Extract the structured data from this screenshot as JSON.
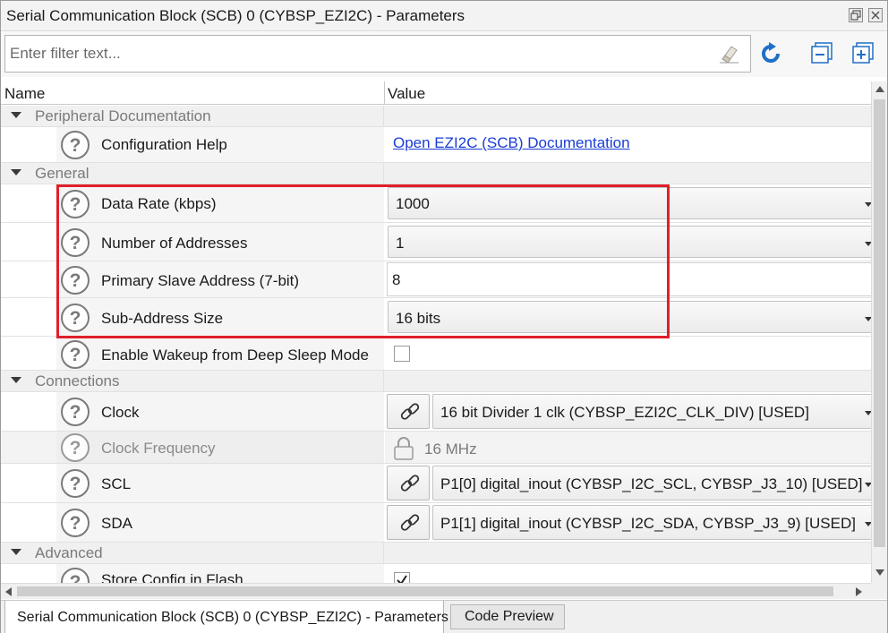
{
  "window": {
    "title": "Serial Communication Block (SCB) 0 (CYBSP_EZI2C) - Parameters"
  },
  "filter": {
    "placeholder": "Enter filter text..."
  },
  "columns": {
    "name": "Name",
    "value": "Value"
  },
  "categories": {
    "peripheral_documentation": "Peripheral Documentation",
    "general": "General",
    "connections": "Connections",
    "advanced": "Advanced"
  },
  "params": {
    "config_help": {
      "label": "Configuration Help",
      "value": "Open EZI2C (SCB) Documentation"
    },
    "data_rate": {
      "label": "Data Rate (kbps)",
      "value": "1000"
    },
    "num_addresses": {
      "label": "Number of Addresses",
      "value": "1"
    },
    "primary_slave_addr": {
      "label": "Primary Slave Address (7-bit)",
      "value": "8"
    },
    "sub_address_size": {
      "label": "Sub-Address Size",
      "value": "16 bits"
    },
    "enable_wakeup": {
      "label": "Enable Wakeup from Deep Sleep Mode",
      "checked": false
    },
    "clock": {
      "label": "Clock",
      "value": "16 bit Divider 1 clk (CYBSP_EZI2C_CLK_DIV) [USED]"
    },
    "clock_frequency": {
      "label": "Clock Frequency",
      "value": "16 MHz"
    },
    "scl": {
      "label": "SCL",
      "value": "P1[0] digital_inout (CYBSP_I2C_SCL, CYBSP_J3_10) [USED]"
    },
    "sda": {
      "label": "SDA",
      "value": "P1[1] digital_inout (CYBSP_I2C_SDA, CYBSP_J3_9) [USED]"
    },
    "store_config": {
      "label": "Store Config in Flash",
      "checked": true
    }
  },
  "tabs": {
    "parameters": "Serial Communication Block (SCB) 0 (CYBSP_EZI2C) - Parameters",
    "code_preview": "Code Preview"
  },
  "colors": {
    "highlight": "#e0202a",
    "link": "#1a3cd6",
    "toolbar_blue": "#1f6fc7"
  }
}
